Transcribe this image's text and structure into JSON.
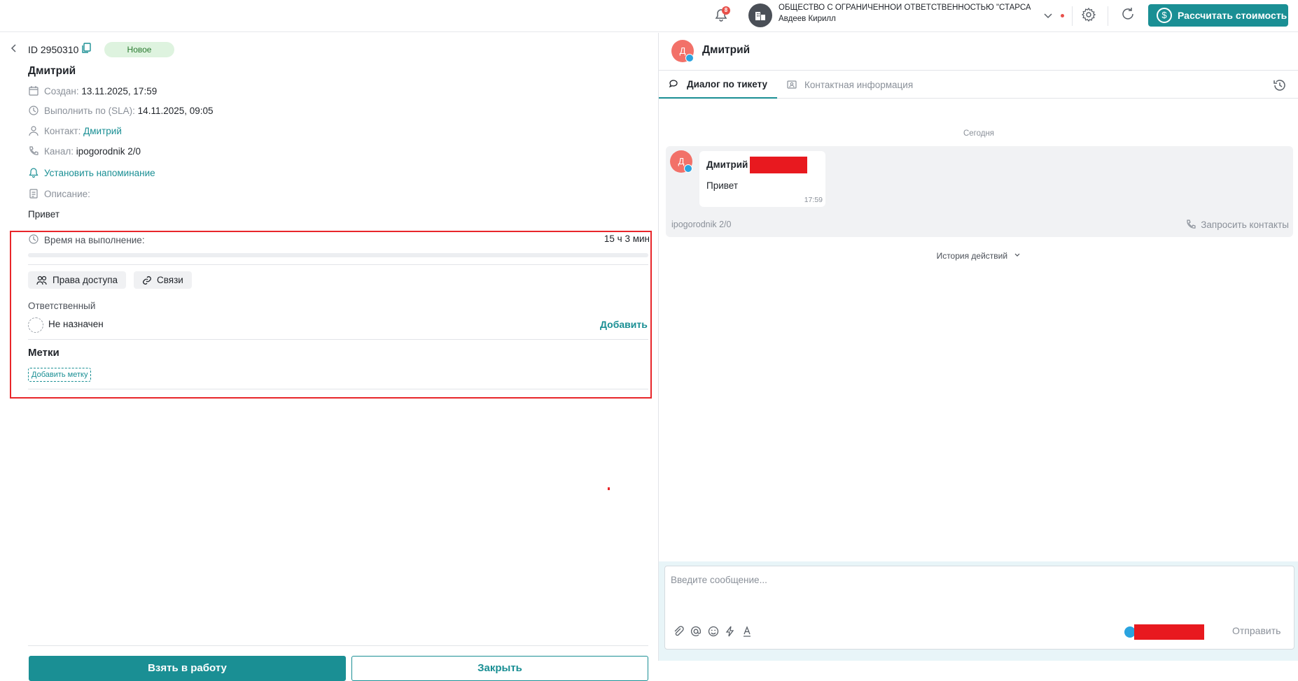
{
  "topbar": {
    "notification_count": "8",
    "organization": "ОБЩЕСТВО С ОГРАНИЧЕННОЙ ОТВЕТСТВЕННОСТЬЮ \"СТАРСАВТО\"...",
    "user": "Авдеев Кирилл",
    "calc_button": "Рассчитать стоимость",
    "accent_color": "#1a8f94"
  },
  "ticket": {
    "id": "ID 2950310",
    "status": "Новое",
    "contact_name": "Дмитрий",
    "created_label": "Создан:",
    "created_value": "13.11.2025, 17:59",
    "sla_label": "Выполнить по (SLA):",
    "sla_value": "14.11.2025, 09:05",
    "contact_label": "Контакт:",
    "contact_value": "Дмитрий",
    "channel_label": "Канал:",
    "channel_value": "ipogorodnik 2/0",
    "reminder": "Установить напоминание",
    "description_label": "Описание:",
    "description_value": "Привет"
  },
  "execution": {
    "time_label": "Время на выполнение:",
    "time_value": "15 ч 3 мин",
    "progress_fraction": 0.0
  },
  "actions": {
    "access": "Права доступа",
    "links": "Связи"
  },
  "responsible": {
    "label": "Ответственный",
    "value": "Не назначен",
    "add": "Добавить"
  },
  "tags": {
    "title": "Метки",
    "add": "Добавить метку"
  },
  "footer": {
    "take": "Взять в работу",
    "close": "Закрыть"
  },
  "chat": {
    "avatar_letter": "Д",
    "name": "Дмитрий",
    "tab_dialog": "Диалог по тикету",
    "tab_contact": "Контактная информация",
    "today": "Сегодня",
    "message": {
      "author": "Дмитрий",
      "text": "Привет",
      "time": "17:59"
    },
    "channel": "ipogorodnik 2/0",
    "request_contacts": "Запросить контакты",
    "actions_history": "История действий",
    "composer_placeholder": "Введите сообщение...",
    "send": "Отправить"
  }
}
